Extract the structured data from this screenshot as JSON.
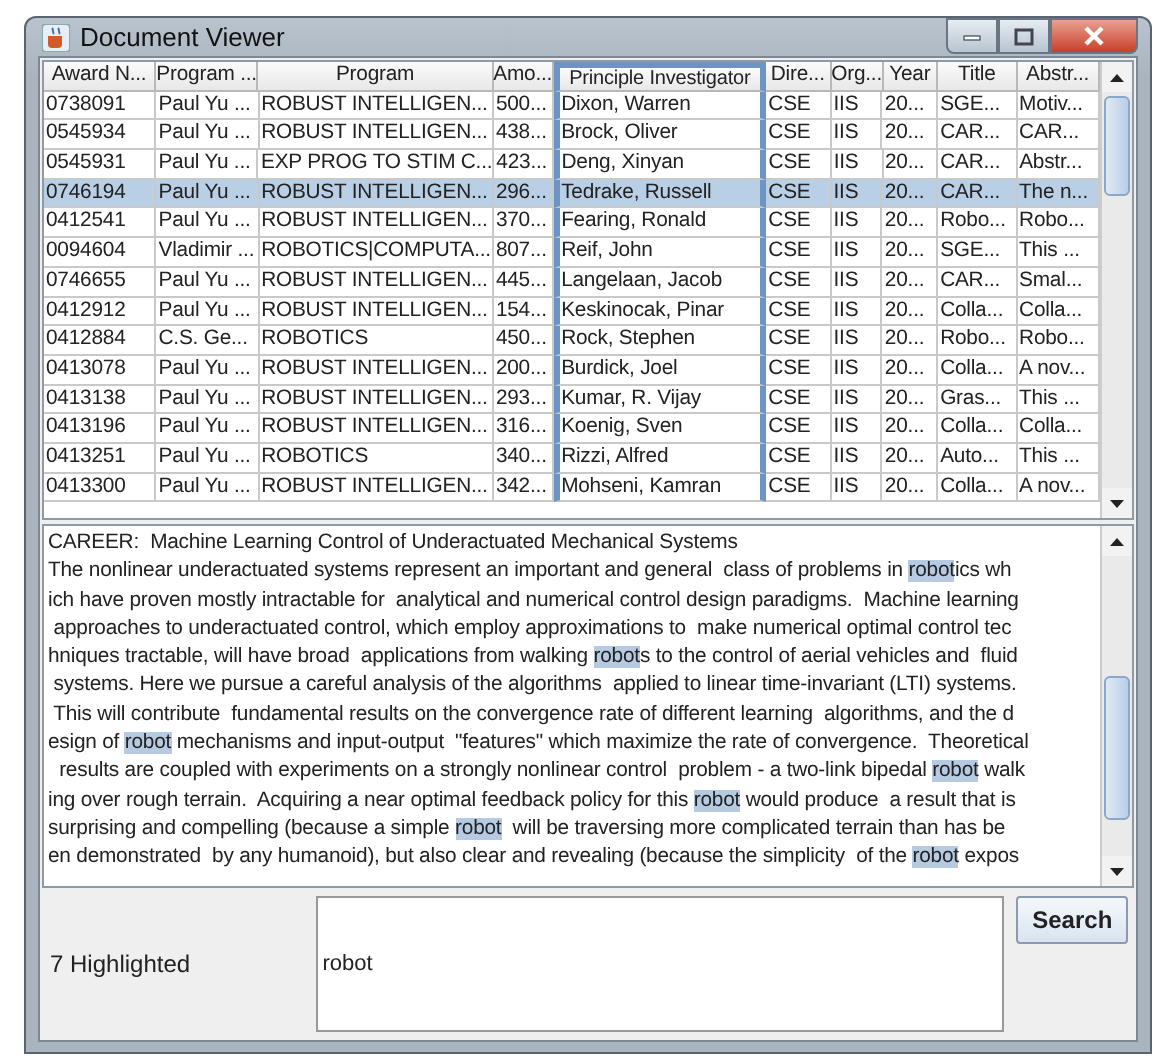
{
  "window": {
    "title": "Document Viewer"
  },
  "table": {
    "columns": [
      {
        "label": "Award N...",
        "selected": false
      },
      {
        "label": "Program ...",
        "selected": false
      },
      {
        "label": "Program",
        "selected": false
      },
      {
        "label": "Amo...",
        "selected": false
      },
      {
        "label": "Principle Investigator",
        "selected": true
      },
      {
        "label": "Dire...",
        "selected": false
      },
      {
        "label": "Org...",
        "selected": false
      },
      {
        "label": "Year",
        "selected": false
      },
      {
        "label": "Title",
        "selected": false
      },
      {
        "label": "Abstr...",
        "selected": false
      }
    ],
    "rows": [
      {
        "selected": false,
        "cells": [
          "0738091",
          "Paul Yu ...",
          "ROBUST INTELLIGEN...",
          "500...",
          "Dixon, Warren",
          "CSE",
          "IIS",
          "20...",
          "SGE...",
          "Motiv..."
        ]
      },
      {
        "selected": false,
        "cells": [
          "0545934",
          "Paul Yu ...",
          "ROBUST INTELLIGEN...",
          "438...",
          "Brock, Oliver",
          "CSE",
          "IIS",
          "20...",
          "CAR...",
          "CAR..."
        ]
      },
      {
        "selected": false,
        "cells": [
          "0545931",
          "Paul Yu ...",
          "EXP PROG TO STIM C...",
          "423...",
          "Deng, Xinyan",
          "CSE",
          "IIS",
          "20...",
          "CAR...",
          "Abstr..."
        ]
      },
      {
        "selected": true,
        "cells": [
          "0746194",
          "Paul Yu ...",
          "ROBUST INTELLIGEN...",
          "296...",
          "Tedrake, Russell",
          "CSE",
          "IIS",
          "20...",
          "CAR...",
          "The n..."
        ]
      },
      {
        "selected": false,
        "cells": [
          "0412541",
          "Paul Yu ...",
          "ROBUST INTELLIGEN...",
          "370...",
          "Fearing, Ronald",
          "CSE",
          "IIS",
          "20...",
          "Robo...",
          "Robo..."
        ]
      },
      {
        "selected": false,
        "cells": [
          "0094604",
          "Vladimir ...",
          "ROBOTICS|COMPUTA...",
          "807...",
          "Reif, John",
          "CSE",
          "IIS",
          "20...",
          "SGE...",
          "This ..."
        ]
      },
      {
        "selected": false,
        "cells": [
          "0746655",
          "Paul Yu ...",
          "ROBUST INTELLIGEN...",
          "445...",
          "Langelaan, Jacob",
          "CSE",
          "IIS",
          "20...",
          "CAR...",
          "Smal..."
        ]
      },
      {
        "selected": false,
        "cells": [
          "0412912",
          "Paul Yu ...",
          "ROBUST INTELLIGEN...",
          "154...",
          "Keskinocak, Pinar",
          "CSE",
          "IIS",
          "20...",
          "Colla...",
          "Colla..."
        ]
      },
      {
        "selected": false,
        "cells": [
          "0412884",
          "C.S. Ge...",
          "ROBOTICS",
          "450...",
          "Rock, Stephen",
          "CSE",
          "IIS",
          "20...",
          "Robo...",
          "Robo..."
        ]
      },
      {
        "selected": false,
        "cells": [
          "0413078",
          "Paul Yu ...",
          "ROBUST INTELLIGEN...",
          "200...",
          "Burdick, Joel",
          "CSE",
          "IIS",
          "20...",
          "Colla...",
          "A nov..."
        ]
      },
      {
        "selected": false,
        "cells": [
          "0413138",
          "Paul Yu ...",
          "ROBUST INTELLIGEN...",
          "293...",
          "Kumar, R. Vijay",
          "CSE",
          "IIS",
          "20...",
          "Gras...",
          "This ..."
        ]
      },
      {
        "selected": false,
        "cells": [
          "0413196",
          "Paul Yu ...",
          "ROBUST INTELLIGEN...",
          "316...",
          "Koenig, Sven",
          "CSE",
          "IIS",
          "20...",
          "Colla...",
          "Colla..."
        ]
      },
      {
        "selected": false,
        "cells": [
          "0413251",
          "Paul Yu ...",
          "ROBOTICS",
          "340...",
          "Rizzi, Alfred",
          "CSE",
          "IIS",
          "20...",
          "Auto...",
          "This ..."
        ]
      },
      {
        "selected": false,
        "cells": [
          "0413300",
          "Paul Yu ...",
          "ROBUST INTELLIGEN...",
          "342...",
          "Mohseni, Kamran",
          "CSE",
          "IIS",
          "20...",
          "Colla...",
          "A nov..."
        ]
      }
    ]
  },
  "document": {
    "lines": [
      [
        {
          "text": "CAREER:  Machine Learning Control of Underactuated Mechanical Systems",
          "highlighted": false
        }
      ],
      [
        {
          "text": "The nonlinear underactuated systems represent an important and general  class of problems in ",
          "highlighted": false
        },
        {
          "text": "robot",
          "highlighted": true
        },
        {
          "text": "ics wh",
          "highlighted": false
        }
      ],
      [
        {
          "text": "ich have proven mostly intractable for  analytical and numerical control design paradigms.  Machine learning",
          "highlighted": false
        }
      ],
      [
        {
          "text": " approaches to underactuated control, which employ approximations to  make numerical optimal control tec",
          "highlighted": false
        }
      ],
      [
        {
          "text": "hniques tractable, will have broad  applications from walking ",
          "highlighted": false
        },
        {
          "text": "robot",
          "highlighted": true
        },
        {
          "text": "s to the control of aerial vehicles and  fluid",
          "highlighted": false
        }
      ],
      [
        {
          "text": " systems. Here we pursue a careful analysis of the algorithms  applied to linear time-invariant (LTI) systems.",
          "highlighted": false
        }
      ],
      [
        {
          "text": " This will contribute  fundamental results on the convergence rate of different learning  algorithms, and the d",
          "highlighted": false
        }
      ],
      [
        {
          "text": "esign of ",
          "highlighted": false
        },
        {
          "text": "robot",
          "highlighted": true
        },
        {
          "text": " mechanisms and input-output  \"features\" which maximize the rate of convergence.  Theoretical",
          "highlighted": false
        }
      ],
      [
        {
          "text": "  results are coupled with experiments on a strongly nonlinear control  problem - a two-link bipedal ",
          "highlighted": false
        },
        {
          "text": "robot",
          "highlighted": true
        },
        {
          "text": " walk",
          "highlighted": false
        }
      ],
      [
        {
          "text": "ing over rough terrain.  Acquiring a near optimal feedback policy for this ",
          "highlighted": false
        },
        {
          "text": "robot",
          "highlighted": true
        },
        {
          "text": " would produce  a result that is",
          "highlighted": false
        }
      ],
      [
        {
          "text": "surprising and compelling (because a simple ",
          "highlighted": false
        },
        {
          "text": "robot",
          "highlighted": true
        },
        {
          "text": "  will be traversing more complicated terrain than has be",
          "highlighted": false
        }
      ],
      [
        {
          "text": "en demonstrated  by any humanoid), but also clear and revealing (because the simplicity  of the ",
          "highlighted": false
        },
        {
          "text": "robot",
          "highlighted": true
        },
        {
          "text": " expos",
          "highlighted": false
        }
      ]
    ]
  },
  "status": {
    "label": "7 Highlighted"
  },
  "search": {
    "value": "robot",
    "button": "Search"
  }
}
